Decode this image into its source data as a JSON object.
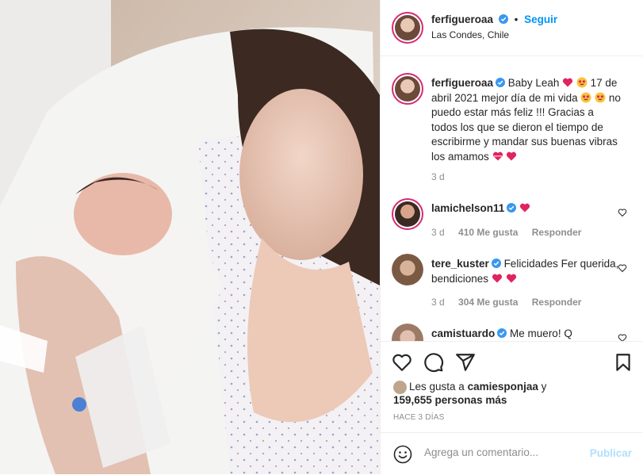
{
  "post": {
    "author": "ferfigueroaa",
    "follow_label": "Seguir",
    "separator": "•",
    "location": "Las Condes, Chile",
    "caption_text_1": "Baby Leah",
    "caption_text_2": "17 de abril 2021 mejor día de mi vida",
    "caption_text_3": "no puedo estar más feliz !!! Gracias a todos los que se dieron el tiempo de escribirme y mandar sus buenas vibras los amamos",
    "caption_age": "3 d"
  },
  "comments": [
    {
      "user": "lamichelson11",
      "text": "",
      "age": "3 d",
      "likes": "410 Me gusta",
      "reply": "Responder"
    },
    {
      "user": "tere_kuster",
      "text": "Felicidades Fer querida, bendiciones",
      "age": "3 d",
      "likes": "304 Me gusta",
      "reply": "Responder"
    },
    {
      "user": "camistuardo",
      "text": "Me muero! Q",
      "age": "",
      "likes": "",
      "reply": ""
    }
  ],
  "likes": {
    "line1": "Les gusta a",
    "user": "camiesponjaa",
    "line1_suffix": "y",
    "line2": "159,655 personas más"
  },
  "timestamp": "HACE 3 DÍAS",
  "comment_box": {
    "placeholder": "Agrega un comentario...",
    "publish_label": "Publicar"
  },
  "icons": {
    "like": "heart-outline-icon",
    "comment": "speech-bubble-icon",
    "share": "paper-plane-icon",
    "save": "bookmark-icon",
    "emoji": "smiley-icon",
    "verified": "verified-badge-icon"
  },
  "colors": {
    "accent": "#0095f6",
    "verified": "#3897f0",
    "heart": "#ed4956",
    "muted": "#8e8e8e",
    "publish_disabled": "#b2dffc"
  }
}
